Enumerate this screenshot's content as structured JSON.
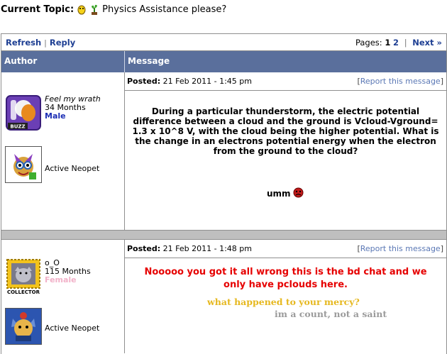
{
  "topic": {
    "label": "Current Topic:",
    "title": "Physics Assistance please?"
  },
  "nav": {
    "refresh": "Refresh",
    "sep": "|",
    "reply": "Reply",
    "pages_label": "Pages:",
    "page1": "1",
    "page2": "2",
    "next": "Next »"
  },
  "headers": {
    "author": "Author",
    "message": "Message"
  },
  "posts": [
    {
      "username": "Feel my wrath",
      "months": "34 Months",
      "gender": "Male",
      "avatar_text": "BUZZ",
      "pet_status": "Active Neopet",
      "posted_label": "Posted:",
      "posted_date": "21 Feb 2011 - 1:45 pm",
      "report": "Report this message",
      "body": "During a particular thunderstorm, the electric potential difference between a cloud and the ground is Vcloud-Vground= 1.3 x 10^8 V, with the cloud being the higher potential. What is the change in an electrons potential energy when the electron from the ground to the cloud?",
      "sig": "umm"
    },
    {
      "username": "o_O",
      "months": "115 Months",
      "gender": "Female",
      "avatar_text": "COLLECTOR",
      "pet_status": "Active Neopet",
      "posted_label": "Posted:",
      "posted_date": "21 Feb 2011 - 1:48 pm",
      "report": "Report this message",
      "body": "Nooooo you got it all wrong this is the bd chat and we only have pclouds here.",
      "sig_line1": "what happened to your mercy?",
      "sig_line2": "im a count, not a saint"
    }
  ],
  "colors": {
    "header_bg": "#5a6f9c",
    "link": "#1e3f93",
    "male": "#1d2fb5",
    "female": "#f2b2c9",
    "red": "#e60000",
    "gold": "#e6b81f"
  }
}
